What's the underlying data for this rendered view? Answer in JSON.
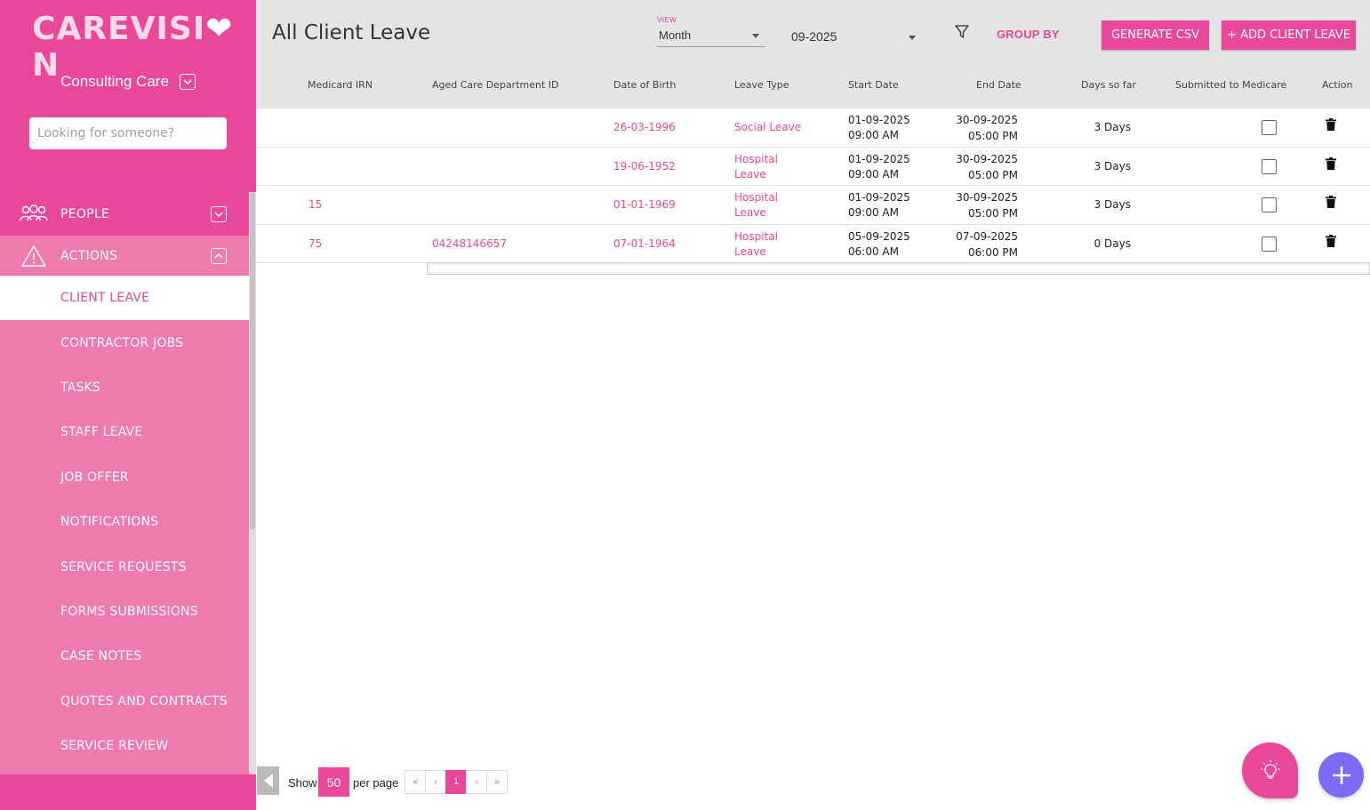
{
  "app": {
    "logo_prefix": "CAREVISI",
    "logo_heart": "❤",
    "logo_suffix": "N",
    "org_name": "Consulting Care"
  },
  "search": {
    "placeholder": "Looking for someone?"
  },
  "nav": {
    "people_label": "PEOPLE",
    "actions_label": "ACTIONS",
    "items": [
      {
        "label": "CLIENT LEAVE",
        "active": true
      },
      {
        "label": "CONTRACTOR JOBS"
      },
      {
        "label": "TASKS"
      },
      {
        "label": "STAFF LEAVE"
      },
      {
        "label": "JOB OFFER"
      },
      {
        "label": "NOTIFICATIONS"
      },
      {
        "label": "SERVICE REQUESTS"
      },
      {
        "label": "FORMS SUBMISSIONS"
      },
      {
        "label": "CASE NOTES"
      },
      {
        "label": "QUOTES AND CONTRACTS"
      },
      {
        "label": "SERVICE REVIEW"
      }
    ]
  },
  "header": {
    "title": "All Client Leave",
    "view_label": "VIEW",
    "view_value": "Month",
    "month_value": "09-2025",
    "group_by": "GROUP BY",
    "csv_button": "GENERATE CSV",
    "add_button": "+ ADD CLIENT LEAVE"
  },
  "table": {
    "columns": [
      "Medicard IRN",
      "Aged Care Department ID",
      "Date of Birth",
      "Leave Type",
      "Start Date",
      "End Date",
      "Days so far",
      "Submitted to Medicare",
      "Action"
    ],
    "rows": [
      {
        "irn": "",
        "acd": "",
        "dob": "26-03-1996",
        "leave1": "Social Leave",
        "leave2": "",
        "start_date": "01-09-2025",
        "start_time": "09:00 AM",
        "end_date": "30-09-2025",
        "end_time": "05:00 PM",
        "days": "3 Days",
        "submitted": false
      },
      {
        "irn": "",
        "acd": "",
        "dob": "19-06-1952",
        "leave1": "Hospital",
        "leave2": "Leave",
        "start_date": "01-09-2025",
        "start_time": "09:00 AM",
        "end_date": "30-09-2025",
        "end_time": "05:00 PM",
        "days": "3 Days",
        "submitted": false
      },
      {
        "irn": "15",
        "acd": "",
        "dob": "01-01-1969",
        "leave1": "Hospital",
        "leave2": "Leave",
        "start_date": "01-09-2025",
        "start_time": "09:00 AM",
        "end_date": "30-09-2025",
        "end_time": "05:00 PM",
        "days": "3 Days",
        "submitted": false
      },
      {
        "irn": "75",
        "acd": "04248146657",
        "dob": "07-01-1964",
        "leave1": "Hospital",
        "leave2": "Leave",
        "start_date": "05-09-2025",
        "start_time": "06:00 AM",
        "end_date": "07-09-2025",
        "end_time": "06:00 PM",
        "days": "0 Days",
        "submitted": false
      }
    ]
  },
  "footer": {
    "show_label": "Show",
    "per_page_value": "50",
    "per_page_label": "per page",
    "pager": [
      "«",
      "‹",
      "1",
      "›",
      "»"
    ],
    "current_page": "1"
  },
  "colors": {
    "brand": "#e8479a",
    "sidebar_light": "#ee7ab0",
    "fab_purple": "#7b6cf6",
    "header_bg": "#e4e4e4"
  },
  "icons": {
    "people": "people-icon",
    "actions": "warning-icon",
    "filter": "filter-icon",
    "delete": "trash-icon",
    "bulb": "lightbulb-icon",
    "add": "plus-icon"
  }
}
